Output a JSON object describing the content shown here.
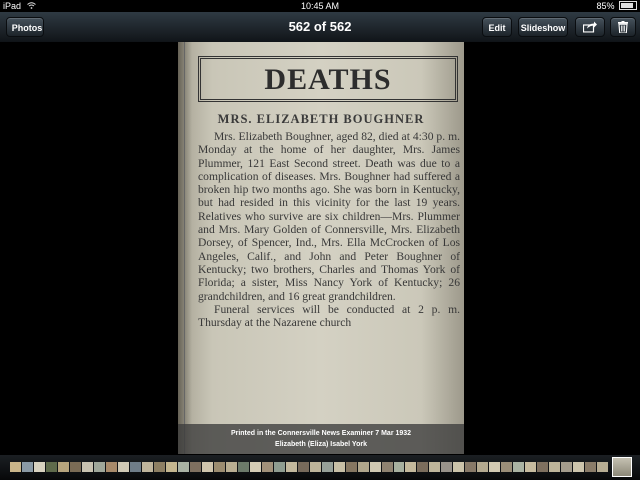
{
  "status_bar": {
    "device": "iPad",
    "time": "10:45 AM",
    "battery": "85%",
    "battery_level": 0.85
  },
  "nav": {
    "back_label": "Photos",
    "title": "562 of 562",
    "edit_label": "Edit",
    "slideshow_label": "Slideshow",
    "share_icon": "share-icon",
    "trash_icon": "trash-icon"
  },
  "photo": {
    "headline": "DEATHS",
    "subhead": "MRS. ELIZABETH BOUGHNER",
    "paragraphs": [
      "Mrs. Elizabeth Boughner, aged 82, died at 4:30 p. m. Monday at the home of her daughter, Mrs. James Plummer, 121 East Second street. Death was due to a complication of diseases. Mrs. Boughner had suffered a broken hip two months ago. She was born in Kentucky, but had resided in this vicinity for the last 19 years. Relatives who survive are six children—Mrs. Plummer and Mrs. Mary Golden of Connersville, Mrs. Elizabeth Dorsey, of Spencer, Ind., Mrs. Ella McCrocken of Los Angeles, Calif., and John and Peter Boughner of Kentucky; two brothers, Charles and Thomas York of Florida; a sister, Miss Nancy York of Kentucky; 26 grandchildren, and 16 great grandchildren.",
      "Funeral services will be conducted at 2 p. m. Thursday at the Nazarene church"
    ]
  },
  "caption": {
    "line1": "Printed in the Connersville News Examiner 7 Mar 1932",
    "line2": "Elizabeth (Eliza) Isabel York"
  },
  "thumbnail_strip": {
    "colors": [
      "#c9b58a",
      "#8a9aa5",
      "#d8d2c0",
      "#5e6a4b",
      "#b6a47d",
      "#7a6b55",
      "#c8c2b0",
      "#9fa79a",
      "#a88a6a",
      "#d0c9b5",
      "#6f7d88",
      "#bfb59c",
      "#8d7f63",
      "#c4b68f",
      "#a9b2a4",
      "#7f7060",
      "#cfc5ad",
      "#9b8c70",
      "#b9ae92",
      "#6c7a6a",
      "#d4ccb5",
      "#a1917a",
      "#8e9c90",
      "#c2b89d",
      "#776a5b",
      "#bdb49a",
      "#96a098",
      "#c7bfa6",
      "#857661",
      "#b0a68c",
      "#cfc8b2",
      "#8f8371",
      "#a7b09f",
      "#c4b99c",
      "#7b6d5c",
      "#bfb69b",
      "#98928a",
      "#cbc3aa",
      "#877968",
      "#b4aa90",
      "#d2cab2",
      "#9a8e78",
      "#aab3a3",
      "#c6bb9f",
      "#7e705f",
      "#beb59a",
      "#a49c8c",
      "#cdc5ad",
      "#8a7c69",
      "#b7ad93"
    ]
  }
}
